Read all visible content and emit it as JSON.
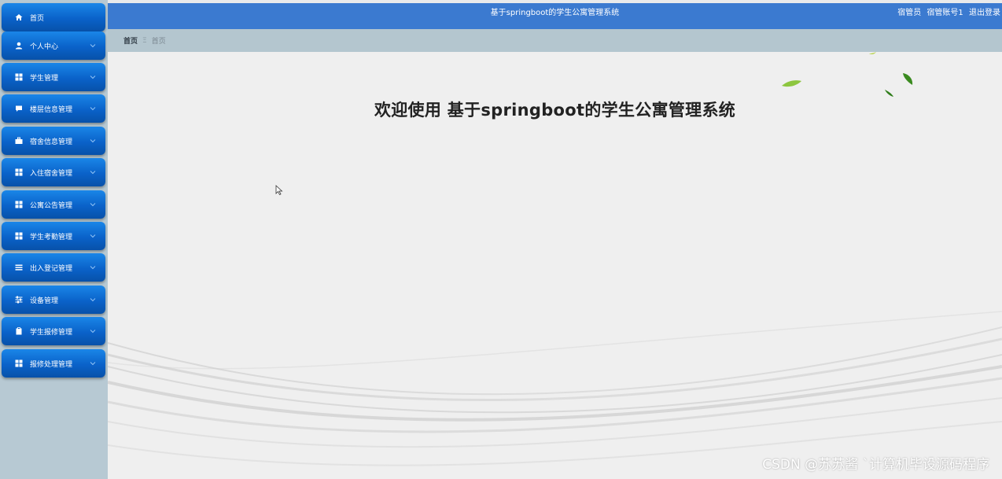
{
  "header": {
    "app_title": "基于springboot的学生公寓管理系统",
    "role": "宿管员",
    "account": "宿管账号1",
    "logout": "退出登录",
    "color": "#3b7ad0"
  },
  "breadcrumb": {
    "home": "首页",
    "separator": "Ξ",
    "current": "首页"
  },
  "sidebar": {
    "items": [
      {
        "label": "首页",
        "icon": "home-icon",
        "has_submenu": false
      },
      {
        "label": "个人中心",
        "icon": "user-icon",
        "has_submenu": true
      },
      {
        "label": "学生管理",
        "icon": "grid-icon",
        "has_submenu": true
      },
      {
        "label": "楼层信息管理",
        "icon": "comment-icon",
        "has_submenu": true
      },
      {
        "label": "宿舍信息管理",
        "icon": "briefcase-icon",
        "has_submenu": true
      },
      {
        "label": "入住宿舍管理",
        "icon": "grid-icon",
        "has_submenu": true
      },
      {
        "label": "公寓公告管理",
        "icon": "grid-icon",
        "has_submenu": true
      },
      {
        "label": "学生考勤管理",
        "icon": "grid-icon",
        "has_submenu": true
      },
      {
        "label": "出入登记管理",
        "icon": "list-icon",
        "has_submenu": true
      },
      {
        "label": "设备管理",
        "icon": "sliders-icon",
        "has_submenu": true
      },
      {
        "label": "学生报修管理",
        "icon": "clipboard-icon",
        "has_submenu": true
      },
      {
        "label": "报修处理管理",
        "icon": "grid-icon",
        "has_submenu": true
      }
    ],
    "item_color": "#0a62c9"
  },
  "main": {
    "welcome": "欢迎使用 基于springboot的学生公寓管理系统"
  },
  "watermark": "CSDN @苏苏酱  `计算机毕设源码程序"
}
